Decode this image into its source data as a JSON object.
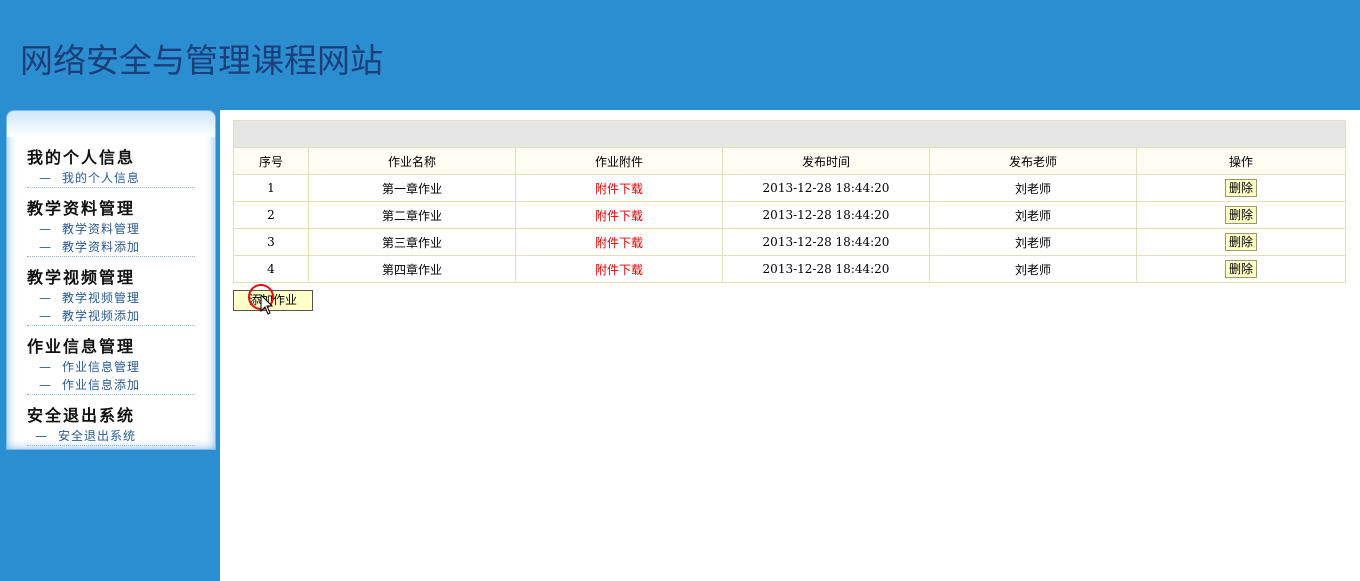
{
  "header": {
    "title": "网络安全与管理课程网站"
  },
  "sidebar": {
    "groups": [
      {
        "title": "我的个人信息",
        "items": [
          "我的个人信息"
        ]
      },
      {
        "title": "教学资料管理",
        "items": [
          "教学资料管理",
          "教学资料添加"
        ]
      },
      {
        "title": "教学视频管理",
        "items": [
          "教学视频管理",
          "教学视频添加"
        ]
      },
      {
        "title": "作业信息管理",
        "items": [
          "作业信息管理",
          "作业信息添加"
        ]
      },
      {
        "title": "安全退出系统",
        "items": [
          "安全退出系统"
        ]
      }
    ]
  },
  "table": {
    "headers": [
      "序号",
      "作业名称",
      "作业附件",
      "发布时间",
      "发布老师",
      "操作"
    ],
    "rows": [
      {
        "no": "1",
        "name": "第一章作业",
        "attachment": "附件下载",
        "time": "2013-12-28 18:44:20",
        "teacher": "刘老师",
        "action": "删除"
      },
      {
        "no": "2",
        "name": "第二章作业",
        "attachment": "附件下载",
        "time": "2013-12-28 18:44:20",
        "teacher": "刘老师",
        "action": "删除"
      },
      {
        "no": "3",
        "name": "第三章作业",
        "attachment": "附件下载",
        "time": "2013-12-28 18:44:20",
        "teacher": "刘老师",
        "action": "删除"
      },
      {
        "no": "4",
        "name": "第四章作业",
        "attachment": "附件下载",
        "time": "2013-12-28 18:44:20",
        "teacher": "刘老师",
        "action": "删除"
      }
    ]
  },
  "add_button": "添加作业",
  "colors": {
    "header_bg": "#2b8ed1",
    "title": "#1a3f7a",
    "link_red": "#e00000",
    "button_bg": "#ffffc8"
  }
}
